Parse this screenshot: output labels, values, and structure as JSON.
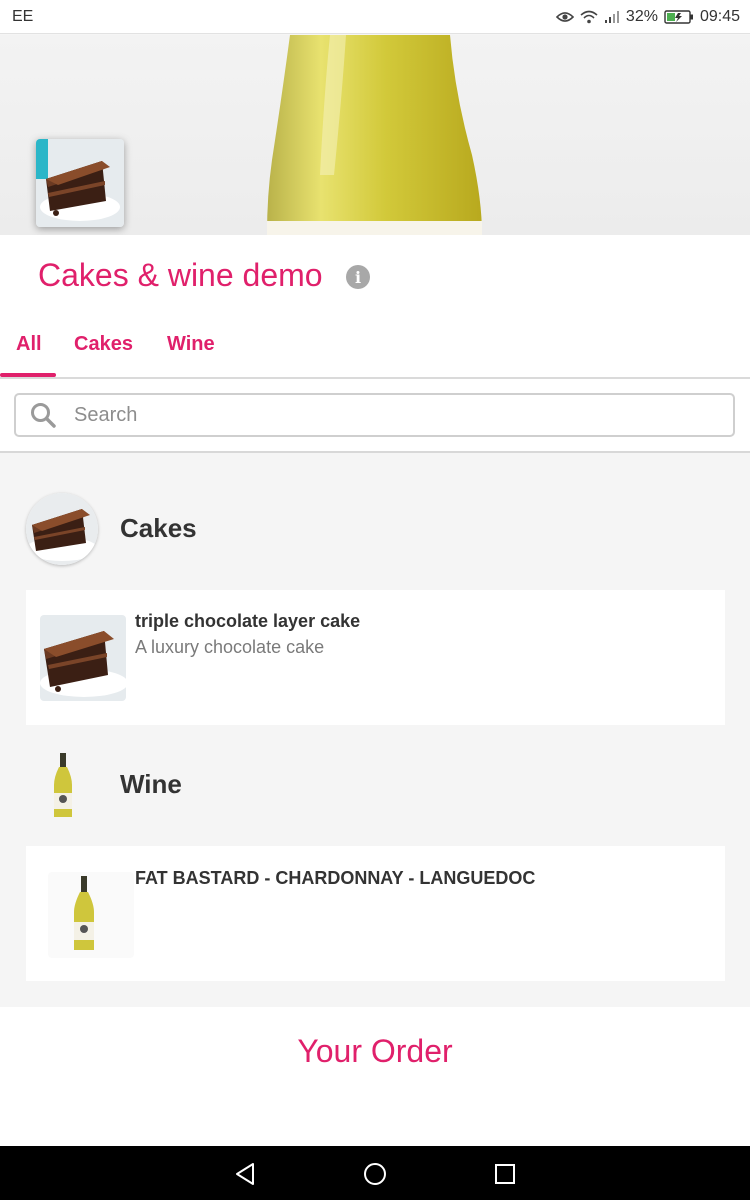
{
  "status_bar": {
    "carrier": "EE",
    "battery": "32%",
    "time": "09:45"
  },
  "header": {
    "title": "Cakes & wine demo",
    "info_icon": "info-icon"
  },
  "tabs": [
    {
      "label": "All",
      "active": true
    },
    {
      "label": "Cakes",
      "active": false
    },
    {
      "label": "Wine",
      "active": false
    }
  ],
  "search": {
    "placeholder": "Search",
    "value": ""
  },
  "categories": [
    {
      "name": "Cakes",
      "products": [
        {
          "name": "triple chocolate layer cake",
          "description": "A luxury chocolate cake"
        }
      ]
    },
    {
      "name": "Wine",
      "products": [
        {
          "name": "FAT BASTARD - CHARDONNAY - LANGUEDOC",
          "description": ""
        }
      ]
    }
  ],
  "order": {
    "label": "Your Order"
  },
  "colors": {
    "accent": "#e0206b",
    "background": "#f5f5f5",
    "card": "#ffffff"
  },
  "nav_bar": {
    "icons": [
      "back-icon",
      "home-icon",
      "recents-icon"
    ]
  }
}
